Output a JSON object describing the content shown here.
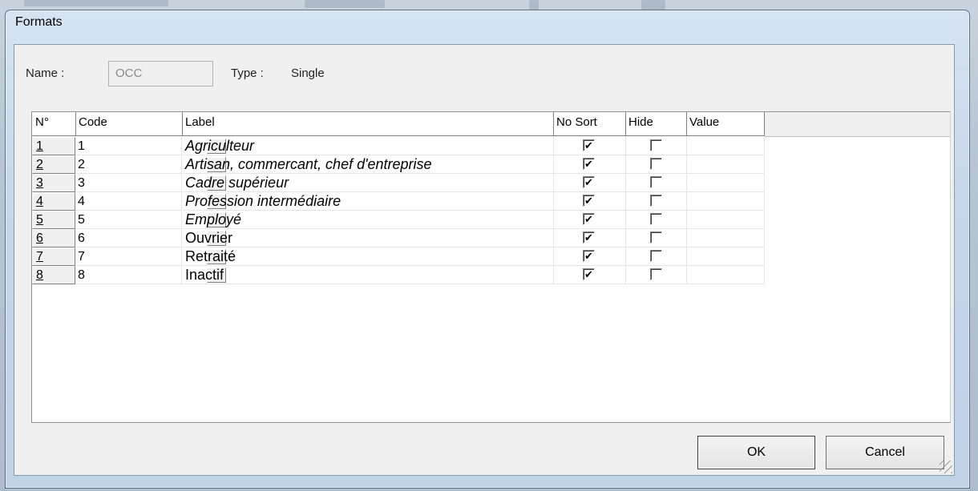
{
  "window": {
    "title": "Formats"
  },
  "form": {
    "name_label": "Name :",
    "name_value": "OCC",
    "type_label": "Type :",
    "type_value": "Single"
  },
  "grid": {
    "columns": [
      "N°",
      "Code",
      "Label",
      "No Sort",
      "Hide",
      "Value"
    ],
    "rows": [
      {
        "num": "1",
        "code": "1",
        "label": "Agriculteur",
        "italic": true,
        "no_sort": true,
        "hide": false,
        "value": ""
      },
      {
        "num": "2",
        "code": "2",
        "label": "Artisan, commercant, chef d'entreprise",
        "italic": true,
        "no_sort": true,
        "hide": false,
        "value": ""
      },
      {
        "num": "3",
        "code": "3",
        "label": "Cadre supérieur",
        "italic": true,
        "no_sort": true,
        "hide": false,
        "value": ""
      },
      {
        "num": "4",
        "code": "4",
        "label": "Profession intermédiaire",
        "italic": true,
        "no_sort": true,
        "hide": false,
        "value": ""
      },
      {
        "num": "5",
        "code": "5",
        "label": "Employé",
        "italic": true,
        "no_sort": true,
        "hide": false,
        "value": ""
      },
      {
        "num": "6",
        "code": "6",
        "label": "Ouvrier",
        "italic": false,
        "no_sort": true,
        "hide": false,
        "value": ""
      },
      {
        "num": "7",
        "code": "7",
        "label": "Retraité",
        "italic": false,
        "no_sort": true,
        "hide": false,
        "value": ""
      },
      {
        "num": "8",
        "code": "8",
        "label": "Inactif",
        "italic": false,
        "no_sort": true,
        "hide": false,
        "value": ""
      }
    ]
  },
  "buttons": {
    "ok": "OK",
    "cancel": "Cancel"
  },
  "icons": {
    "checkbox_checked": "check-mark",
    "resize_grip": "resize-grip-icon"
  }
}
